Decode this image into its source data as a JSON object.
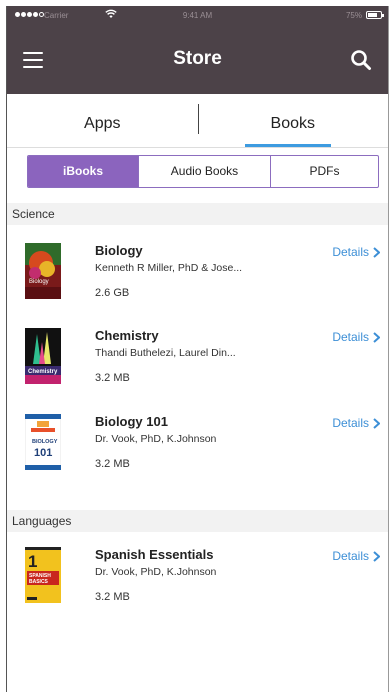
{
  "status": {
    "carrier": "Carrier",
    "time": "9:41 AM",
    "battery_pct": "75%",
    "battery_level": 0.75
  },
  "navbar": {
    "title": "Store"
  },
  "tabs": [
    {
      "label": "Apps",
      "selected": false
    },
    {
      "label": "Books",
      "selected": true
    }
  ],
  "filters": [
    {
      "label": "iBooks",
      "selected": true
    },
    {
      "label": "Audio Books",
      "selected": false
    },
    {
      "label": "PDFs",
      "selected": false
    }
  ],
  "sections": [
    {
      "header": "Science",
      "books": [
        {
          "title": "Biology",
          "author": "Kenneth R Miller, PhD & Jose...",
          "size": "2.6 GB",
          "details": "Details"
        },
        {
          "title": "Chemistry",
          "author": "Thandi Buthelezi, Laurel Din...",
          "size": "3.2 MB",
          "details": "Details"
        },
        {
          "title": "Biology 101",
          "author": "Dr. Vook, PhD, K.Johnson",
          "size": "3.2 MB",
          "details": "Details"
        }
      ]
    },
    {
      "header": "Languages",
      "books": [
        {
          "title": "Spanish Essentials",
          "author": "Dr. Vook, PhD, K.Johnson",
          "size": "3.2 MB",
          "details": "Details"
        }
      ]
    }
  ],
  "cover_text": {
    "biology": "Biology",
    "chemistry": "Chemistry",
    "biology101_line1": "BIOLOGY",
    "biology101_line2": "101",
    "spanish_number": "1",
    "spanish_line1": "SPANISH",
    "spanish_line2": "BASICS"
  },
  "colors": {
    "bar_bg": "#4c4248",
    "accent_purple": "#8b64be",
    "link_blue": "#3d8fd6",
    "tab_underline": "#3d9be0"
  }
}
